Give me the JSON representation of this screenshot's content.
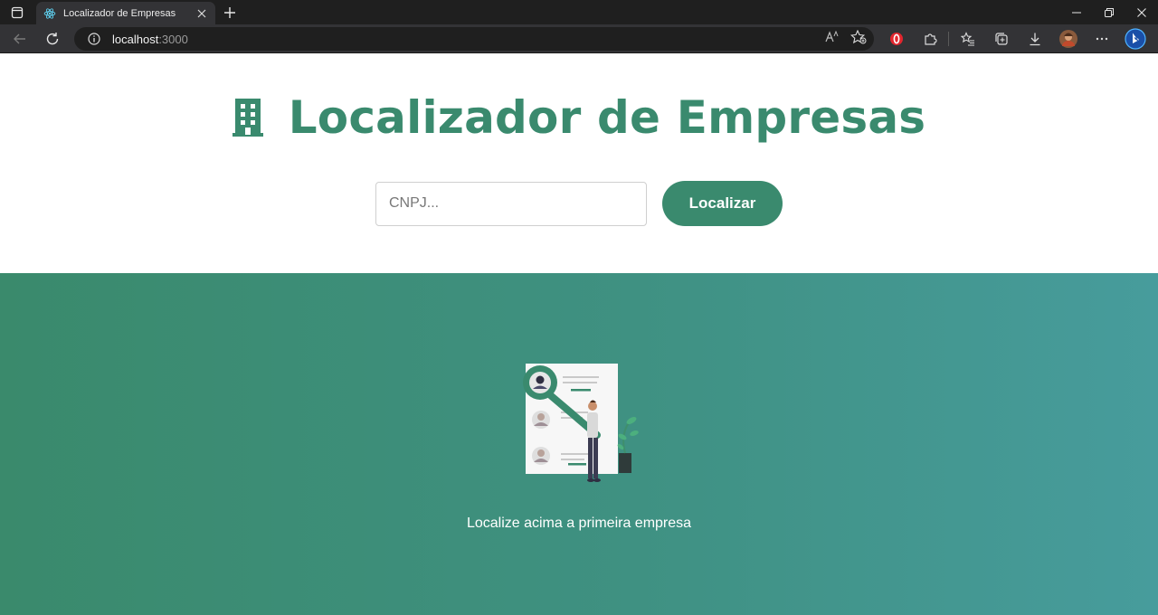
{
  "browser": {
    "tab_title": "Localizador de Empresas",
    "address_host": "localhost",
    "address_port": ":3000"
  },
  "header": {
    "title": "Localizador de Empresas"
  },
  "search": {
    "placeholder": "CNPJ...",
    "value": "",
    "button_label": "Localizar"
  },
  "results": {
    "empty_message": "Localize acima a primeira empresa"
  },
  "colors": {
    "brand_green": "#3a8a6e",
    "gradient_start": "#3a8a6c",
    "gradient_end": "#479c9c",
    "chrome_dark": "#1f1f1f",
    "chrome_toolbar": "#333336"
  }
}
